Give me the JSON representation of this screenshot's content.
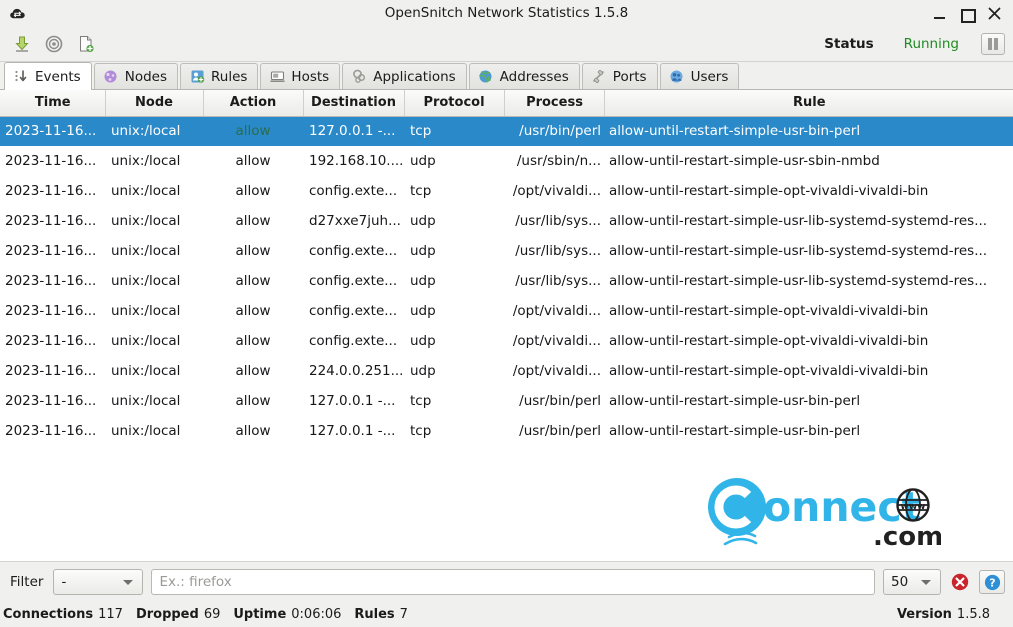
{
  "window": {
    "title": "OpenSnitch Network Statistics 1.5.8",
    "icon": "opensnitch-cloud-icon",
    "controls": {
      "minimize": "minimize-icon",
      "maximize": "maximize-icon",
      "close": "close-icon"
    }
  },
  "toolbar": {
    "icons": [
      {
        "name": "export-download-icon",
        "title": "Export"
      },
      {
        "name": "target-circle-icon",
        "title": "Preferences"
      },
      {
        "name": "new-document-icon",
        "title": "New rule"
      }
    ],
    "status_label": "Status",
    "status_value": "Running",
    "status_color": "#1f8c1f",
    "pause_button": "pause-icon"
  },
  "tabs": [
    {
      "label": "Events",
      "icon": "events-icon",
      "active": true
    },
    {
      "label": "Nodes",
      "icon": "nodes-icon",
      "active": false
    },
    {
      "label": "Rules",
      "icon": "rules-icon",
      "active": false
    },
    {
      "label": "Hosts",
      "icon": "hosts-icon",
      "active": false
    },
    {
      "label": "Applications",
      "icon": "applications-icon",
      "active": false
    },
    {
      "label": "Addresses",
      "icon": "addresses-icon",
      "active": false
    },
    {
      "label": "Ports",
      "icon": "ports-icon",
      "active": false
    },
    {
      "label": "Users",
      "icon": "users-icon",
      "active": false
    }
  ],
  "table": {
    "columns": [
      "Time",
      "Node",
      "Action",
      "Destination",
      "Protocol",
      "Process",
      "Rule"
    ],
    "selected_index": 0,
    "rows": [
      {
        "time": "2023-11-16...",
        "node": "unix:/local",
        "action": "allow",
        "destination": "127.0.0.1  -...",
        "protocol": "tcp",
        "process": "/usr/bin/perl",
        "rule": "allow-until-restart-simple-usr-bin-perl"
      },
      {
        "time": "2023-11-16...",
        "node": "unix:/local",
        "action": "allow",
        "destination": "192.168.10....",
        "protocol": "udp",
        "process": "/usr/sbin/n...",
        "rule": "allow-until-restart-simple-usr-sbin-nmbd"
      },
      {
        "time": "2023-11-16...",
        "node": "unix:/local",
        "action": "allow",
        "destination": "config.exte...",
        "protocol": "tcp",
        "process": "/opt/vivaldi...",
        "rule": "allow-until-restart-simple-opt-vivaldi-vivaldi-bin"
      },
      {
        "time": "2023-11-16...",
        "node": "unix:/local",
        "action": "allow",
        "destination": "d27xxe7juh...",
        "protocol": "udp",
        "process": "/usr/lib/sys...",
        "rule": "allow-until-restart-simple-usr-lib-systemd-systemd-res..."
      },
      {
        "time": "2023-11-16...",
        "node": "unix:/local",
        "action": "allow",
        "destination": "config.exte...",
        "protocol": "udp",
        "process": "/usr/lib/sys...",
        "rule": "allow-until-restart-simple-usr-lib-systemd-systemd-res..."
      },
      {
        "time": "2023-11-16...",
        "node": "unix:/local",
        "action": "allow",
        "destination": "config.exte...",
        "protocol": "udp",
        "process": "/usr/lib/sys...",
        "rule": "allow-until-restart-simple-usr-lib-systemd-systemd-res..."
      },
      {
        "time": "2023-11-16...",
        "node": "unix:/local",
        "action": "allow",
        "destination": "config.exte...",
        "protocol": "udp",
        "process": "/opt/vivaldi...",
        "rule": "allow-until-restart-simple-opt-vivaldi-vivaldi-bin"
      },
      {
        "time": "2023-11-16...",
        "node": "unix:/local",
        "action": "allow",
        "destination": "config.exte...",
        "protocol": "udp",
        "process": "/opt/vivaldi...",
        "rule": "allow-until-restart-simple-opt-vivaldi-vivaldi-bin"
      },
      {
        "time": "2023-11-16...",
        "node": "unix:/local",
        "action": "allow",
        "destination": "224.0.0.251...",
        "protocol": "udp",
        "process": "/opt/vivaldi...",
        "rule": "allow-until-restart-simple-opt-vivaldi-vivaldi-bin"
      },
      {
        "time": "2023-11-16...",
        "node": "unix:/local",
        "action": "allow",
        "destination": "127.0.0.1  -...",
        "protocol": "tcp",
        "process": "/usr/bin/perl",
        "rule": "allow-until-restart-simple-usr-bin-perl"
      },
      {
        "time": "2023-11-16...",
        "node": "unix:/local",
        "action": "allow",
        "destination": "127.0.0.1  -...",
        "protocol": "tcp",
        "process": "/usr/bin/perl",
        "rule": "allow-until-restart-simple-usr-bin-perl"
      }
    ]
  },
  "watermark": {
    "text_main": "onnect",
    "text_c": "C",
    "text_www": "www",
    "text_com": ".com"
  },
  "filterbar": {
    "label": "Filter",
    "filter_value": "-",
    "search_placeholder": "Ex.: firefox",
    "search_value": "",
    "limit_value": "50",
    "clear_button": "clear-icon",
    "help_button": "help-icon"
  },
  "statusbar": {
    "connections_label": "Connections",
    "connections_value": "117",
    "dropped_label": "Dropped",
    "dropped_value": "69",
    "uptime_label": "Uptime",
    "uptime_value": "0:06:06",
    "rules_label": "Rules",
    "rules_value": "7",
    "version_label": "Version",
    "version_value": "1.5.8"
  },
  "colors": {
    "selection": "#2a89c8",
    "allow": "#2f6f4f",
    "running": "#1f8c1f"
  }
}
